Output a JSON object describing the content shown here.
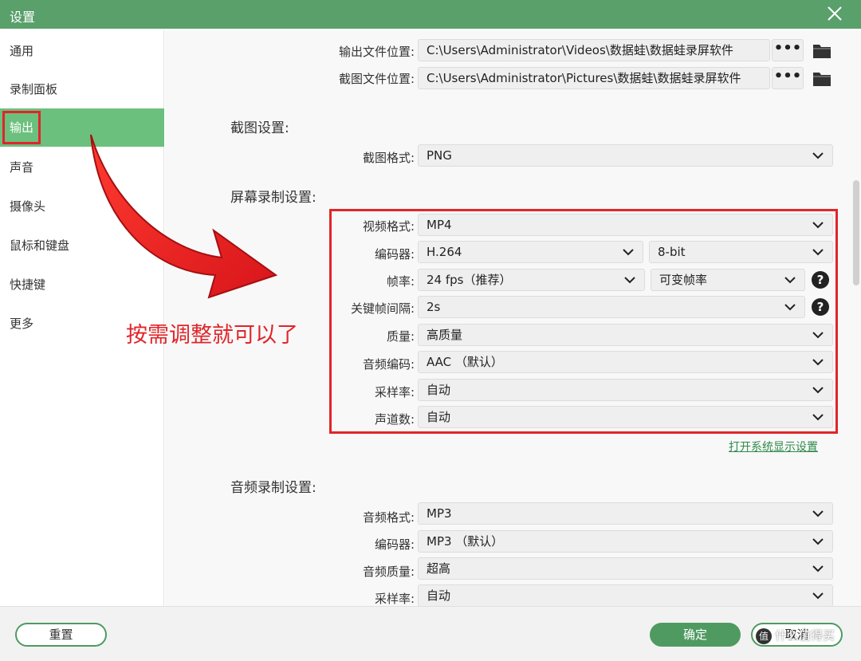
{
  "window": {
    "title": "设置"
  },
  "sidebar": {
    "items": [
      {
        "label": "通用"
      },
      {
        "label": "录制面板"
      },
      {
        "label": "输出"
      },
      {
        "label": "声音"
      },
      {
        "label": "摄像头"
      },
      {
        "label": "鼠标和键盘"
      },
      {
        "label": "快捷键"
      },
      {
        "label": "更多"
      }
    ],
    "active_index": 2
  },
  "paths": {
    "output_label": "输出文件位置:",
    "output_value": "C:\\Users\\Administrator\\Videos\\数据蛙\\数据蛙录屏软件",
    "screenshot_label": "截图文件位置:",
    "screenshot_value": "C:\\Users\\Administrator\\Pictures\\数据蛙\\数据蛙录屏软件",
    "browse_label": "•••"
  },
  "screenshot_settings": {
    "title": "截图设置:",
    "format_label": "截图格式:",
    "format_value": "PNG"
  },
  "screen_recording": {
    "title": "屏幕录制设置:",
    "video_format_label": "视频格式:",
    "video_format_value": "MP4",
    "encoder_label": "编码器:",
    "encoder_value": "H.264",
    "bit_depth_value": "8-bit",
    "frame_rate_label": "帧率:",
    "frame_rate_value": "24 fps（推荐）",
    "frame_mode_value": "可变帧率",
    "keyframe_label": "关键帧间隔:",
    "keyframe_value": "2s",
    "quality_label": "质量:",
    "quality_value": "高质量",
    "audio_codec_label": "音频编码:",
    "audio_codec_value": "AAC （默认）",
    "sample_rate_label": "采样率:",
    "sample_rate_value": "自动",
    "channels_label": "声道数:",
    "channels_value": "自动",
    "display_link": "打开系统显示设置"
  },
  "audio_recording": {
    "title": "音频录制设置:",
    "format_label": "音频格式:",
    "format_value": "MP3",
    "encoder_label": "编码器:",
    "encoder_value": "MP3 （默认）",
    "quality_label": "音频质量:",
    "quality_value": "超高",
    "sample_rate_label": "采样率:",
    "sample_rate_value": "自动"
  },
  "footer": {
    "reset_label": "重置",
    "ok_label": "确定",
    "cancel_label": "取消"
  },
  "annotation": {
    "text": "按需调整就可以了"
  },
  "watermark": {
    "badge": "值",
    "text": "什么值得买"
  },
  "colors": {
    "titlebar": "#5aa06b",
    "sidebar_active": "#6cc07d",
    "highlight_red": "#e0252a",
    "button_green": "#4f9a61",
    "link_green": "#2f8a4a"
  }
}
